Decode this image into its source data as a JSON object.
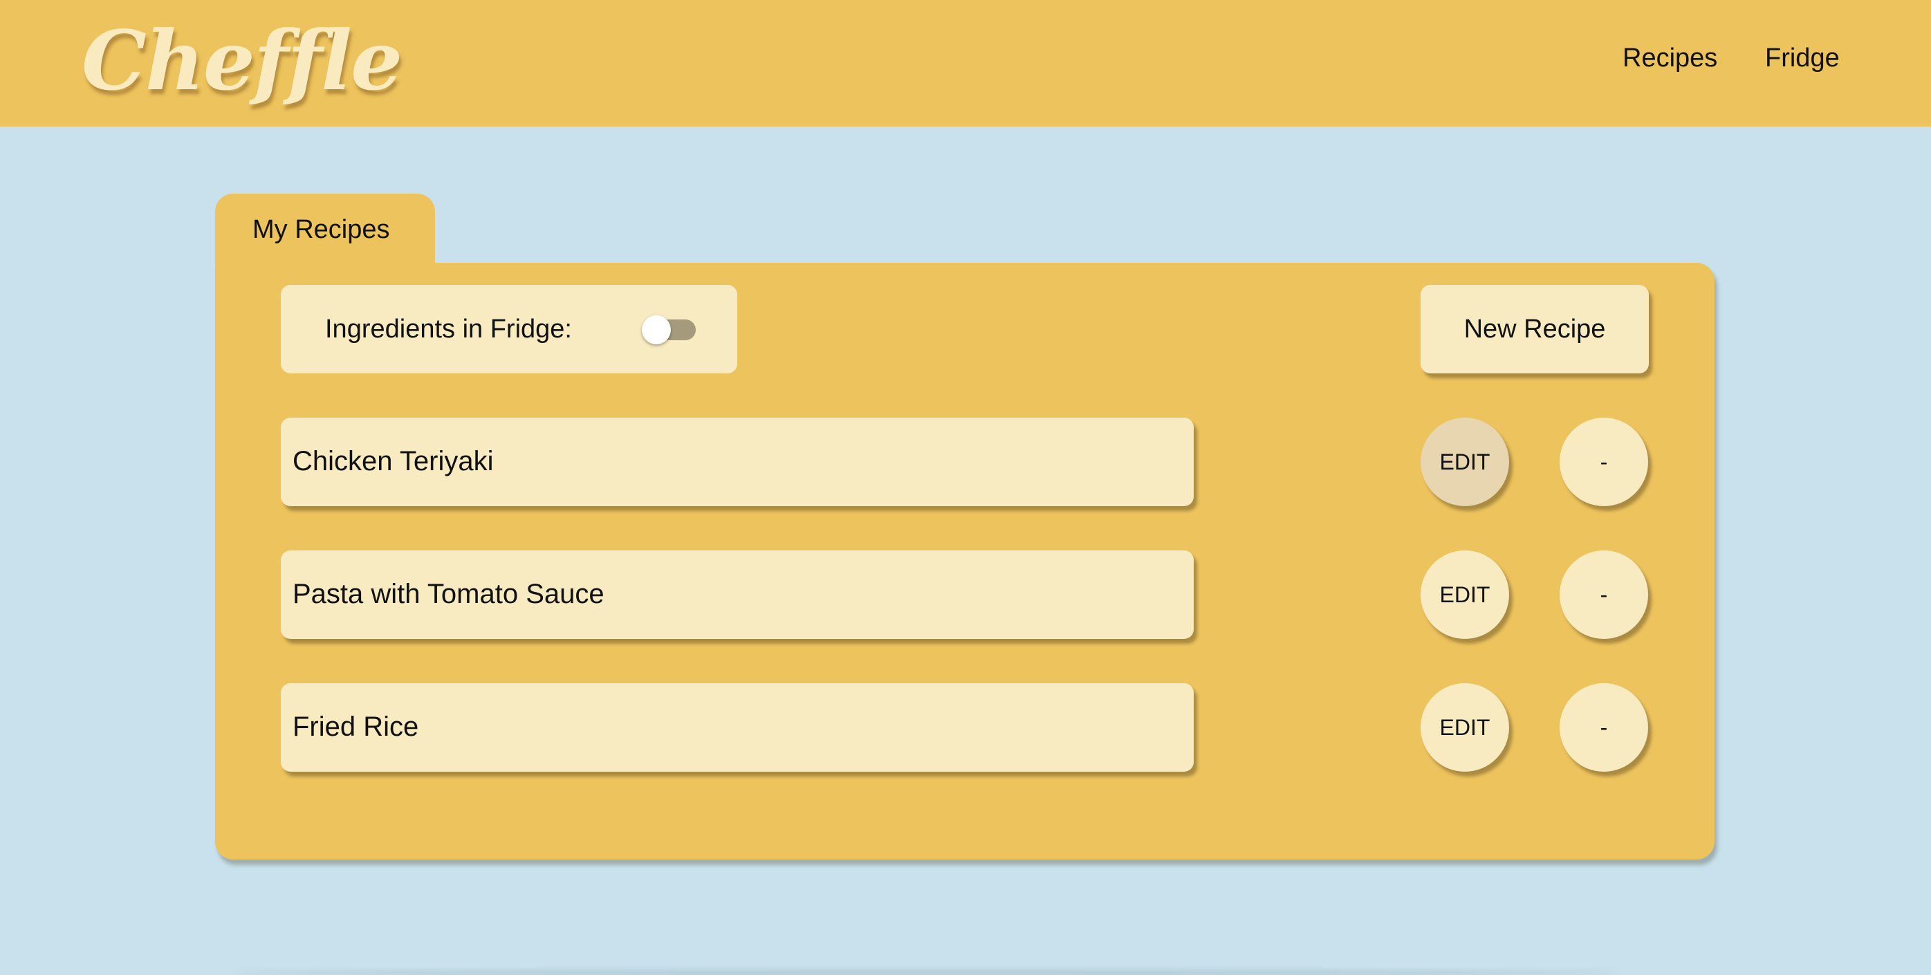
{
  "app": {
    "logo": "Cheffle"
  },
  "nav": {
    "recipes": "Recipes",
    "fridge": "Fridge"
  },
  "panel": {
    "tab_label": "My Recipes",
    "fridge_filter": {
      "label": "Ingredients in Fridge:",
      "enabled": false
    },
    "new_recipe_label": "New Recipe",
    "recipes": [
      {
        "name": "Chicken Teriyaki",
        "edit_label": "EDIT",
        "remove_label": "-"
      },
      {
        "name": "Pasta with Tomato Sauce",
        "edit_label": "EDIT",
        "remove_label": "-"
      },
      {
        "name": "Fried Rice",
        "edit_label": "EDIT",
        "remove_label": "-"
      }
    ]
  },
  "colors": {
    "header_bg": "#edc35d",
    "page_bg": "#c8e1ec",
    "card_bg": "#f9ebc1",
    "logo_text": "#f9ebbf",
    "edit_hover_bg": "#e7d6af",
    "toggle_track": "#a59a7c"
  }
}
